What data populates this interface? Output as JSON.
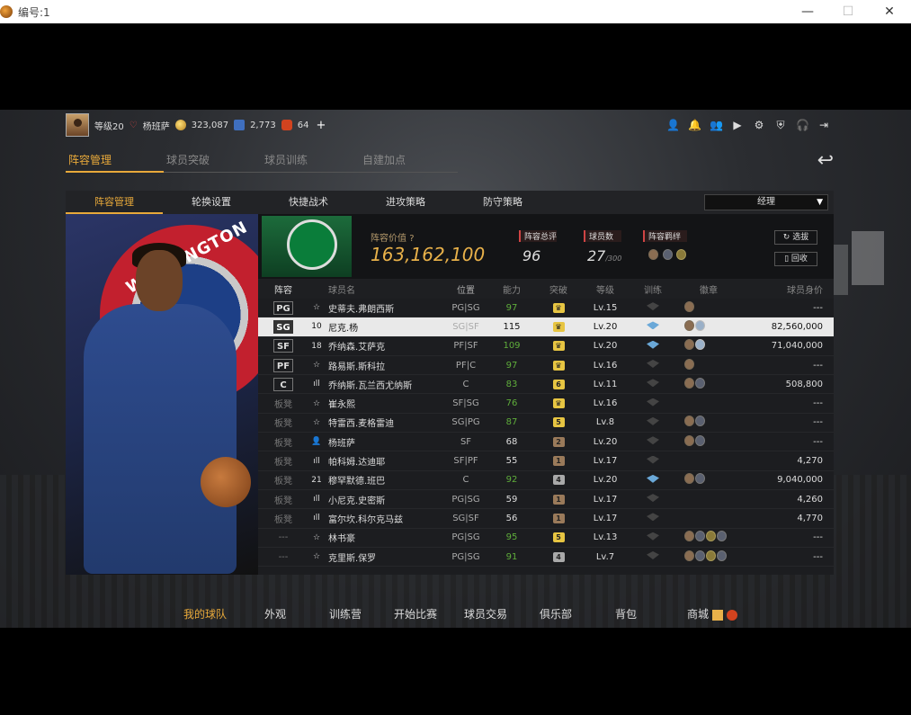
{
  "window": {
    "title": "编号:1",
    "minimize": "—",
    "maximize": "☐",
    "close": "✕"
  },
  "topbar": {
    "level": "等级20",
    "name": "杨班萨",
    "coins": "323,087",
    "points": "2,773",
    "tickets": "64",
    "plus": "+"
  },
  "top_tabs": [
    "阵容管理",
    "球员突破",
    "球员训练",
    "自建加点"
  ],
  "sub_tabs": [
    "阵容管理",
    "轮换设置",
    "快捷战术",
    "进攻策略",
    "防守策略"
  ],
  "role_select": {
    "value": "经理"
  },
  "lineup": {
    "value_label": "阵容价值",
    "value": "163,162,100",
    "rating_label": "阵容总评",
    "rating": "96",
    "count_label": "球员数",
    "count": "27",
    "count_max": "/300",
    "bond_label": "阵容羁绊",
    "btn_pick": "选拔",
    "btn_recycle": "回收"
  },
  "columns": [
    "阵容",
    "球员名",
    "位置",
    "能力",
    "突破",
    "等级",
    "训练",
    "徽章",
    "球员身价"
  ],
  "rows": [
    {
      "slot": "PG",
      "icon": "☆",
      "name": "史蒂夫.弗朗西斯",
      "pos": "PG|SG",
      "ovr": "97",
      "green": true,
      "brk": "♛",
      "brk_color": "#e7c542",
      "lv": "Lv.15",
      "train": false,
      "badges": [
        "n"
      ],
      "value": "---"
    },
    {
      "slot": "SG",
      "icon": "10",
      "name": "尼克.杨",
      "pos": "SG|SF",
      "ovr": "115",
      "green": false,
      "brk": "♛",
      "brk_color": "#e7c542",
      "lv": "Lv.20",
      "train": true,
      "badges": [
        "n",
        "l"
      ],
      "value": "82,560,000",
      "selected": true
    },
    {
      "slot": "SF",
      "icon": "18",
      "name": "乔纳森.艾萨克",
      "pos": "PF|SF",
      "ovr": "109",
      "green": true,
      "brk": "♛",
      "brk_color": "#e7c542",
      "lv": "Lv.20",
      "train": true,
      "badges": [
        "n",
        "l"
      ],
      "value": "71,040,000"
    },
    {
      "slot": "PF",
      "icon": "☆",
      "name": "路易斯.斯科拉",
      "pos": "PF|C",
      "ovr": "97",
      "green": true,
      "brk": "♛",
      "brk_color": "#e7c542",
      "lv": "Lv.16",
      "train": false,
      "badges": [
        "n"
      ],
      "value": "---"
    },
    {
      "slot": "C",
      "icon": "ıll",
      "name": "乔纳斯.瓦兰西尤纳斯",
      "pos": "C",
      "ovr": "83",
      "green": true,
      "brk": "6",
      "brk_color": "#e7c542",
      "lv": "Lv.11",
      "train": false,
      "badges": [
        "n",
        "b"
      ],
      "value": "508,800"
    },
    {
      "slot": "板凳",
      "icon": "☆",
      "name": "崔永熙",
      "pos": "SF|SG",
      "ovr": "76",
      "green": true,
      "brk": "♛",
      "brk_color": "#e7c542",
      "lv": "Lv.16",
      "train": false,
      "badges": [],
      "value": "---"
    },
    {
      "slot": "板凳",
      "icon": "☆",
      "name": "特雷西.麦格雷迪",
      "pos": "SG|PG",
      "ovr": "87",
      "green": true,
      "brk": "5",
      "brk_color": "#e7c542",
      "lv": "Lv.8",
      "train": false,
      "badges": [
        "n",
        "b"
      ],
      "value": "---"
    },
    {
      "slot": "板凳",
      "icon": "👤",
      "name": "杨班萨",
      "pos": "SF",
      "ovr": "68",
      "green": false,
      "brk": "2",
      "brk_color": "#9a7a5a",
      "lv": "Lv.20",
      "train": false,
      "badges": [
        "n",
        "b"
      ],
      "value": "---"
    },
    {
      "slot": "板凳",
      "icon": "ıll",
      "name": "帕科姆.达迪耶",
      "pos": "SF|PF",
      "ovr": "55",
      "green": false,
      "brk": "1",
      "brk_color": "#9a7a5a",
      "lv": "Lv.17",
      "train": false,
      "badges": [],
      "value": "4,270"
    },
    {
      "slot": "板凳",
      "icon": "21",
      "name": "穆罕默德.班巴",
      "pos": "C",
      "ovr": "92",
      "green": true,
      "brk": "4",
      "brk_color": "#a9a9a9",
      "lv": "Lv.20",
      "train": true,
      "badges": [
        "n",
        "b"
      ],
      "value": "9,040,000"
    },
    {
      "slot": "板凳",
      "icon": "ıll",
      "name": "小尼克.史密斯",
      "pos": "PG|SG",
      "ovr": "59",
      "green": false,
      "brk": "1",
      "brk_color": "#9a7a5a",
      "lv": "Lv.17",
      "train": false,
      "badges": [],
      "value": "4,260"
    },
    {
      "slot": "板凳",
      "icon": "ıll",
      "name": "富尔坎.科尔克马兹",
      "pos": "SG|SF",
      "ovr": "56",
      "green": false,
      "brk": "1",
      "brk_color": "#9a7a5a",
      "lv": "Lv.17",
      "train": false,
      "badges": [],
      "value": "4,770"
    },
    {
      "slot": "---",
      "icon": "☆",
      "name": "林书豪",
      "pos": "PG|SG",
      "ovr": "95",
      "green": true,
      "brk": "5",
      "brk_color": "#e7c542",
      "lv": "Lv.13",
      "train": false,
      "badges": [
        "n",
        "b",
        "g",
        "b"
      ],
      "value": "---"
    },
    {
      "slot": "---",
      "icon": "☆",
      "name": "克里斯.保罗",
      "pos": "PG|SG",
      "ovr": "91",
      "green": true,
      "brk": "4",
      "brk_color": "#a9a9a9",
      "lv": "Lv.7",
      "train": false,
      "badges": [
        "n",
        "b",
        "g",
        "b"
      ],
      "value": "---"
    }
  ],
  "bottom_nav": [
    "我的球队",
    "外观",
    "训练营",
    "开始比赛",
    "球员交易",
    "俱乐部",
    "背包",
    "商城"
  ],
  "art": {
    "team_text": "WASHINGTON"
  }
}
